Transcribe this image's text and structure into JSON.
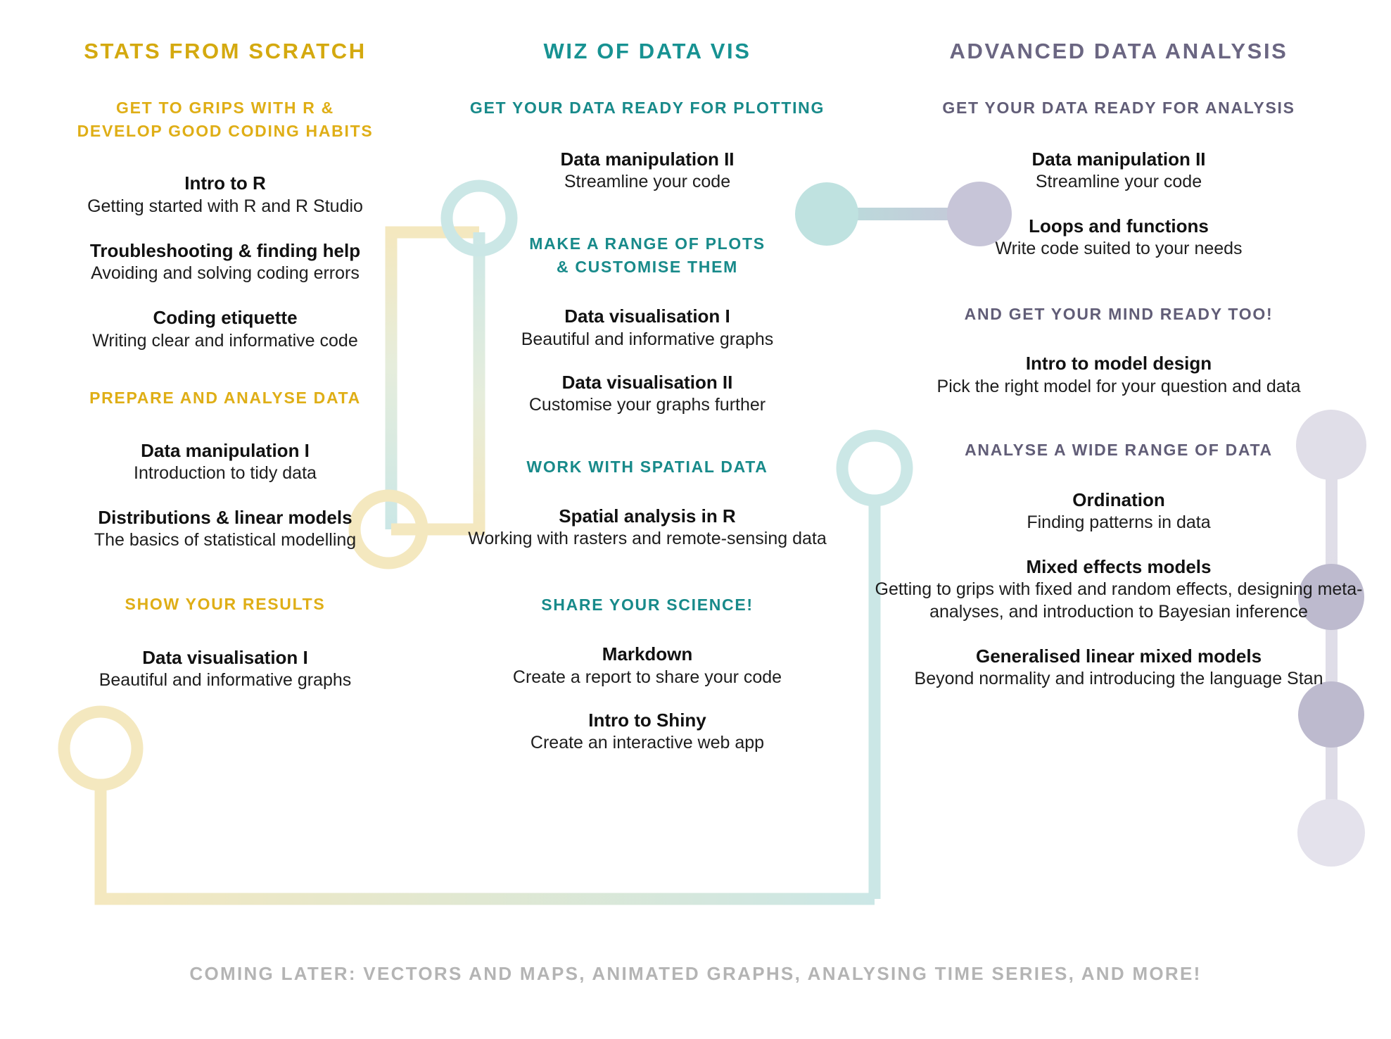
{
  "palette": {
    "yellow_title": "#d4a90f",
    "yellow_section": "#dfae16",
    "yellow_connector": "#f4e8bf",
    "teal_title": "#179292",
    "teal_section": "#188a8a",
    "teal_connector": "#cbe7e6",
    "purple_title": "#6b6682",
    "purple_section": "#615d77",
    "purple_connector_light": "#e0dee8",
    "purple_connector_mid": "#bdbace",
    "body_text": "#111111",
    "footer_text": "#b4b4b4",
    "background": "#ffffff"
  },
  "columns": [
    {
      "id": "stats-from-scratch",
      "title": "STATS FROM SCRATCH",
      "sections": [
        {
          "heading": "GET TO GRIPS WITH R &\nDEVELOP GOOD CODING HABITS",
          "heading_lines": [
            "GET TO GRIPS WITH R &",
            "DEVELOP GOOD CODING HABITS"
          ],
          "items": [
            {
              "title": "Intro to R",
              "subtitle": "Getting started with R and R Studio"
            },
            {
              "title": "Troubleshooting & finding help",
              "subtitle": "Avoiding and solving coding errors"
            },
            {
              "title": "Coding etiquette",
              "subtitle": "Writing clear and informative code"
            }
          ]
        },
        {
          "heading": "PREPARE AND ANALYSE DATA",
          "heading_lines": [
            "PREPARE AND ANALYSE DATA"
          ],
          "items": [
            {
              "title": "Data manipulation I",
              "subtitle": "Introduction to tidy data"
            },
            {
              "title": "Distributions & linear models",
              "subtitle": "The basics of statistical modelling"
            }
          ]
        },
        {
          "heading": "SHOW YOUR RESULTS",
          "heading_lines": [
            "SHOW YOUR RESULTS"
          ],
          "items": [
            {
              "title": "Data visualisation I",
              "subtitle": "Beautiful and informative graphs"
            }
          ]
        }
      ]
    },
    {
      "id": "wiz-of-data-vis",
      "title": "WIZ OF DATA VIS",
      "sections": [
        {
          "heading": "GET YOUR DATA READY FOR PLOTTING",
          "heading_lines": [
            "GET YOUR DATA READY FOR PLOTTING"
          ],
          "items": [
            {
              "title": "Data manipulation II",
              "subtitle": "Streamline your code"
            }
          ]
        },
        {
          "heading": "MAKE A RANGE OF PLOTS\n& CUSTOMISE THEM",
          "heading_lines": [
            "MAKE A RANGE OF PLOTS",
            "& CUSTOMISE THEM"
          ],
          "items": [
            {
              "title": "Data visualisation I",
              "subtitle": "Beautiful and informative graphs"
            },
            {
              "title": "Data visualisation II",
              "subtitle": "Customise your graphs further"
            }
          ]
        },
        {
          "heading": "WORK WITH SPATIAL DATA",
          "heading_lines": [
            "WORK WITH SPATIAL DATA"
          ],
          "items": [
            {
              "title": "Spatial analysis in R",
              "subtitle": "Working with rasters and remote-sensing data"
            }
          ]
        },
        {
          "heading": "SHARE YOUR SCIENCE!",
          "heading_lines": [
            "SHARE YOUR SCIENCE!"
          ],
          "items": [
            {
              "title": "Markdown",
              "subtitle": "Create a report to share your code"
            },
            {
              "title": "Intro to Shiny",
              "subtitle": "Create an interactive web app"
            }
          ]
        }
      ]
    },
    {
      "id": "advanced-data-analysis",
      "title": "ADVANCED DATA ANALYSIS",
      "sections": [
        {
          "heading": "GET YOUR DATA READY FOR ANALYSIS",
          "heading_lines": [
            "GET YOUR DATA READY FOR ANALYSIS"
          ],
          "items": [
            {
              "title": "Data manipulation II",
              "subtitle": "Streamline your code"
            },
            {
              "title": "Loops and functions",
              "subtitle": "Write code suited to your needs"
            }
          ]
        },
        {
          "heading": "AND GET YOUR MIND READY TOO!",
          "heading_lines": [
            "AND GET YOUR MIND READY TOO!"
          ],
          "items": [
            {
              "title": "Intro to model design",
              "subtitle": "Pick the right model for your question and data"
            }
          ]
        },
        {
          "heading": "ANALYSE A WIDE RANGE OF DATA",
          "heading_lines": [
            "ANALYSE A WIDE RANGE OF DATA"
          ],
          "items": [
            {
              "title": "Ordination",
              "subtitle": "Finding patterns in data"
            },
            {
              "title": "Mixed effects models",
              "subtitle": "Getting to grips with fixed and random effects, designing meta-analyses, and introduction to Bayesian inference"
            },
            {
              "title": "Generalised linear mixed models",
              "subtitle": "Beyond normality and introducing the language Stan"
            }
          ]
        }
      ]
    }
  ],
  "footer": {
    "text": "COMING LATER: VECTORS AND MAPS, ANIMATED GRAPHS, ANALYSING TIME SERIES, AND MORE!"
  }
}
